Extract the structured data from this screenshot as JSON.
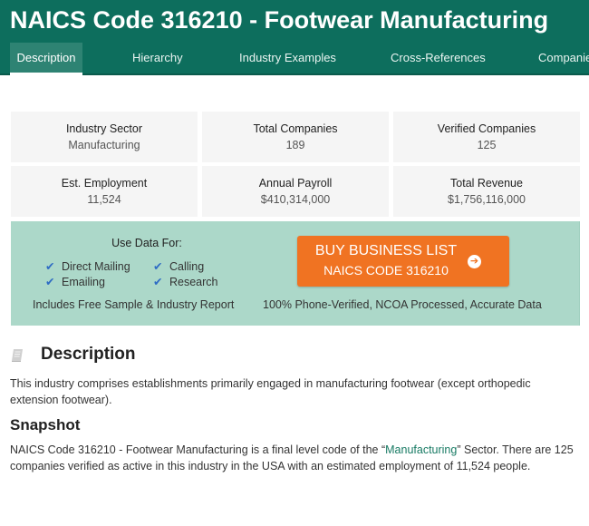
{
  "header": {
    "title": "NAICS Code 316210 - Footwear Manufacturing",
    "tabs": [
      {
        "label": "Description",
        "active": true
      },
      {
        "label": "Hierarchy",
        "active": false
      },
      {
        "label": "Industry Examples",
        "active": false
      },
      {
        "label": "Cross-References",
        "active": false
      },
      {
        "label": "Companies",
        "active": false
      }
    ]
  },
  "stats": [
    {
      "label": "Industry Sector",
      "value": "Manufacturing"
    },
    {
      "label": "Total Companies",
      "value": "189"
    },
    {
      "label": "Verified Companies",
      "value": "125"
    },
    {
      "label": "Est. Employment",
      "value": "11,524"
    },
    {
      "label": "Annual Payroll",
      "value": "$410,314,000"
    },
    {
      "label": "Total Revenue",
      "value": "$1,756,116,000"
    }
  ],
  "promo": {
    "use_title": "Use Data For:",
    "uses": [
      "Direct Mailing",
      "Calling",
      "Emailing",
      "Research"
    ],
    "check_glyph": "✔",
    "includes": "Includes Free Sample & Industry Report",
    "button_line1": "BUY BUSINESS LIST",
    "button_line2": "NAICS CODE 316210",
    "button_icon": "arrow-circle-right-icon",
    "arrow_glyph": "➔",
    "accuracy": "100% Phone-Verified, NCOA Processed, Accurate Data",
    "button_color": "#f07322",
    "background_color": "#acd8c9"
  },
  "description": {
    "icon": "book-icon",
    "title": "Description",
    "text": "This industry comprises establishments primarily engaged in manufacturing footwear (except orthopedic extension footwear)."
  },
  "snapshot": {
    "title": "Snapshot",
    "text_before": "NAICS Code 316210 - Footwear Manufacturing is a final level code of the “",
    "link": "Manufacturing",
    "text_after": "” Sector. There are 125 companies verified as active in this industry in the USA with an estimated employment of 11,524 people."
  },
  "colors": {
    "brand": "#0d6e5d",
    "active_tab": "#2e8373",
    "link": "#177a63",
    "check": "#2d6bc4"
  }
}
